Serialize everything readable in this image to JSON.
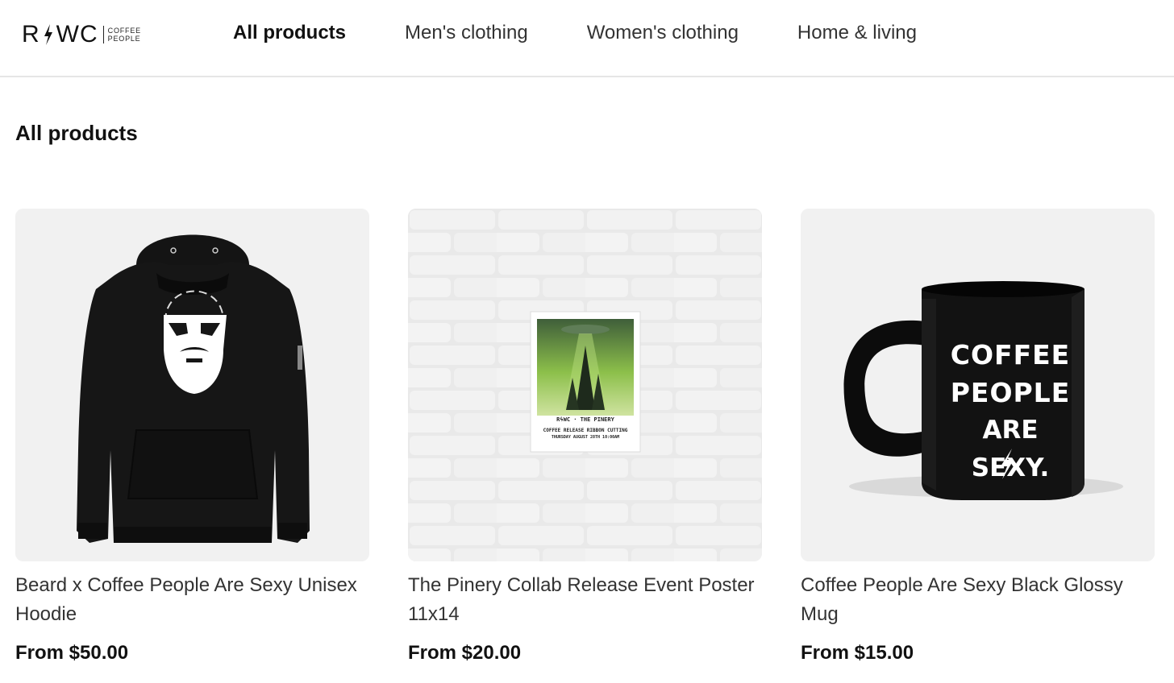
{
  "brand": {
    "logo_text_left": "R",
    "logo_text_right": "WC",
    "logo_sub_line1": "COFFEE",
    "logo_sub_line2": "PEOPLE"
  },
  "nav": {
    "items": [
      {
        "label": "All products",
        "active": true
      },
      {
        "label": "Men's clothing",
        "active": false
      },
      {
        "label": "Women's clothing",
        "active": false
      },
      {
        "label": "Home & living",
        "active": false
      }
    ]
  },
  "page": {
    "title": "All products"
  },
  "products": [
    {
      "name": "Beard x Coffee People Are Sexy Unisex Hoodie",
      "price": "From $50.00",
      "image_icon": "hoodie-image"
    },
    {
      "name": "The Pinery Collab Release Event Poster 11x14",
      "price": "From $20.00",
      "image_icon": "poster-image",
      "poster": {
        "line1": "RϟWC · THE PINERY",
        "line2": "COFFEE RELEASE RIBBON CUTTING",
        "line3": "THURSDAY AUGUST 28TH 10:00AM"
      }
    },
    {
      "name": "Coffee People Are Sexy Black Glossy Mug",
      "price": "From $15.00",
      "image_icon": "mug-image",
      "mug": {
        "line1": "COFFEE",
        "line2": "PEOPLE",
        "line3": "ARE SEXY."
      }
    }
  ],
  "colors": {
    "card_background": "#f1f1f1",
    "header_border": "#e6e6e6",
    "poster_green": "#8cbf4a"
  }
}
